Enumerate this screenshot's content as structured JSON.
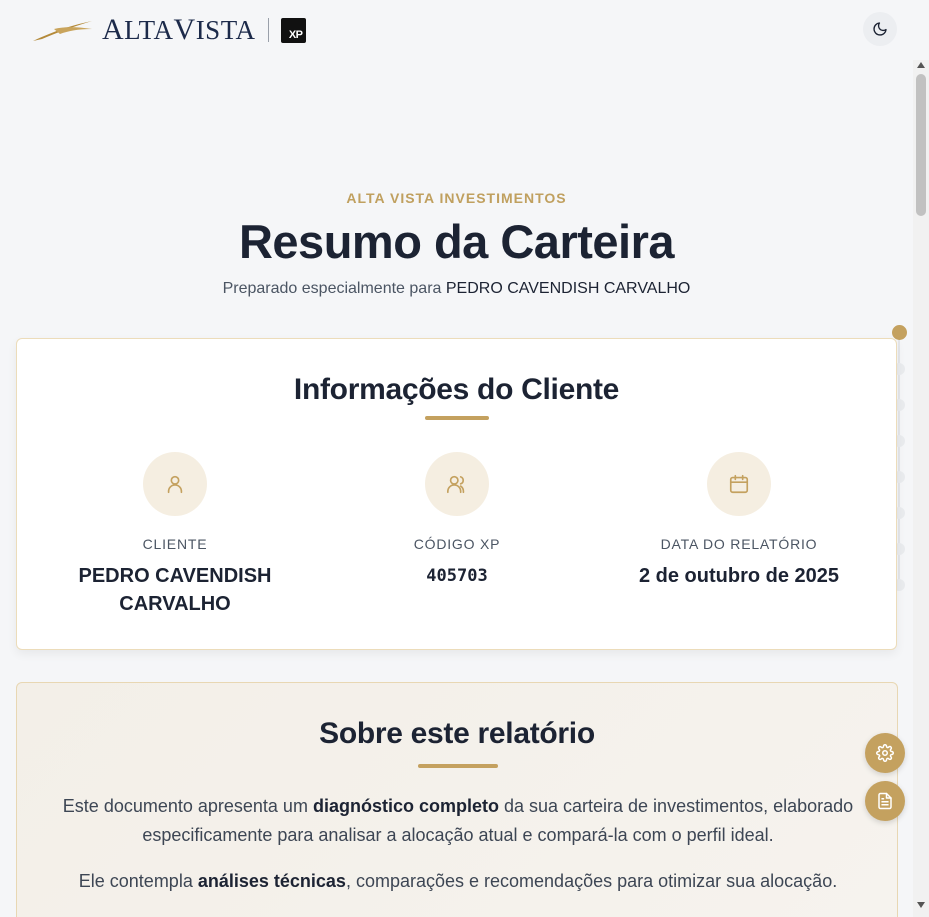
{
  "header": {
    "brand_logo_text": "ALTAVISTA",
    "partner_logo_text": "XP"
  },
  "hero": {
    "eyebrow": "ALTA VISTA INVESTIMENTOS",
    "title": "Resumo da Carteira",
    "subtitle_prefix": "Preparado especialmente para",
    "client_name": "PEDRO CAVENDISH CARVALHO"
  },
  "client_card": {
    "title": "Informações do Cliente",
    "items": [
      {
        "icon": "user-icon",
        "label": "CLIENTE",
        "value": "PEDRO CAVENDISH CARVALHO"
      },
      {
        "icon": "users-icon",
        "label": "CÓDIGO XP",
        "value": "405703"
      },
      {
        "icon": "calendar-icon",
        "label": "DATA DO RELATÓRIO",
        "value": "2 de outubro de 2025"
      }
    ]
  },
  "about_card": {
    "title": "Sobre este relatório",
    "p1_a": "Este documento apresenta um ",
    "p1_bold": "diagnóstico completo",
    "p1_b": " da sua carteira de investimentos, elaborado especificamente para analisar a alocação atual e compará-la com o perfil ideal.",
    "p2_a": "Ele contempla ",
    "p2_bold": "análises técnicas",
    "p2_b": ", comparações e recomendações para otimizar sua alocação."
  },
  "section_nav": {
    "total_sections": 8,
    "active_index": 0
  },
  "colors": {
    "accent": "#c4a15f",
    "text": "#1c2333",
    "background": "#f5f6f8"
  },
  "fabs": [
    {
      "icon": "gear-icon"
    },
    {
      "icon": "document-icon"
    }
  ]
}
